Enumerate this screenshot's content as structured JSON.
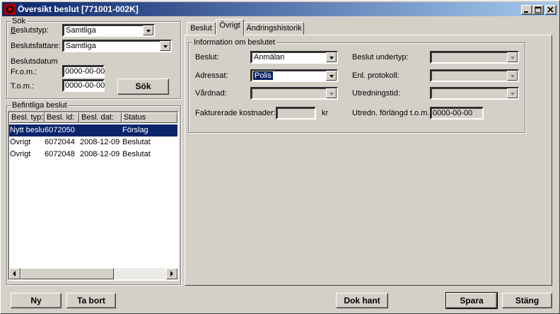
{
  "window": {
    "title": "Översikt beslut  [771001-002K]",
    "controls": {
      "minimize": "minimize-icon",
      "maximize": "maximize-icon",
      "close": "close-icon"
    }
  },
  "search": {
    "group_label": "Sök",
    "beslutstyp_label": "Beslutstyp:",
    "beslutstyp_value": "Samtliga",
    "beslutsfattare_label": "Beslutsfattare:",
    "beslutsfattare_value": "Samtliga",
    "beslutsdatum_label": "Beslutsdatum",
    "from_label": "Fr.o.m.:",
    "from_value": "0000-00-00",
    "tom_label": "T.o.m.:",
    "tom_value": "0000-00-00",
    "search_button": "Sök"
  },
  "existing": {
    "group_label": "Befintliga beslut",
    "columns": [
      "Besl. typ:",
      "Besl. id:",
      "Besl. dat:",
      "Status"
    ],
    "rows": [
      {
        "typ": "Nytt beslut",
        "id": "6072050",
        "dat": "",
        "status": "Förslag",
        "selected": true
      },
      {
        "typ": "Övrigt",
        "id": "6072044",
        "dat": "2008-12-09",
        "status": "Beslutat",
        "selected": false
      },
      {
        "typ": "Övrigt",
        "id": "6072048",
        "dat": "2008-12-09",
        "status": "Beslutat",
        "selected": false
      }
    ]
  },
  "tabs": [
    "Beslut",
    "Övrigt",
    "Ändringshistorik"
  ],
  "active_tab": "Övrigt",
  "info": {
    "group_label": "Information om beslutet",
    "beslut_label": "Beslut:",
    "beslut_value": "Anmälan",
    "adressat_label": "Adressat:",
    "adressat_value": "Polis",
    "vardnad_label": "Vårdnad:",
    "vardnad_value": "",
    "undertyp_label": "Beslut undertyp:",
    "undertyp_value": "",
    "protokoll_label": "Enl. protokoll:",
    "protokoll_value": "",
    "utredningstid_label": "Utredningstid:",
    "utredningstid_value": "",
    "kostnader_label": "Fakturerade kostnader:",
    "kostnader_value": "",
    "kostnader_unit": "kr",
    "forlangd_label": "Utredn. förlängd t.o.m.:",
    "forlangd_value": "0000-00-00"
  },
  "buttons": {
    "ny": "Ny",
    "ta_bort": "Ta bort",
    "dok_hant": "Dok hant",
    "spara": "Spara",
    "stang": "Stäng"
  },
  "colors": {
    "title_start": "#0a246a",
    "title_end": "#a6caf0",
    "selection": "#0a246a",
    "face": "#d4d0c8"
  }
}
